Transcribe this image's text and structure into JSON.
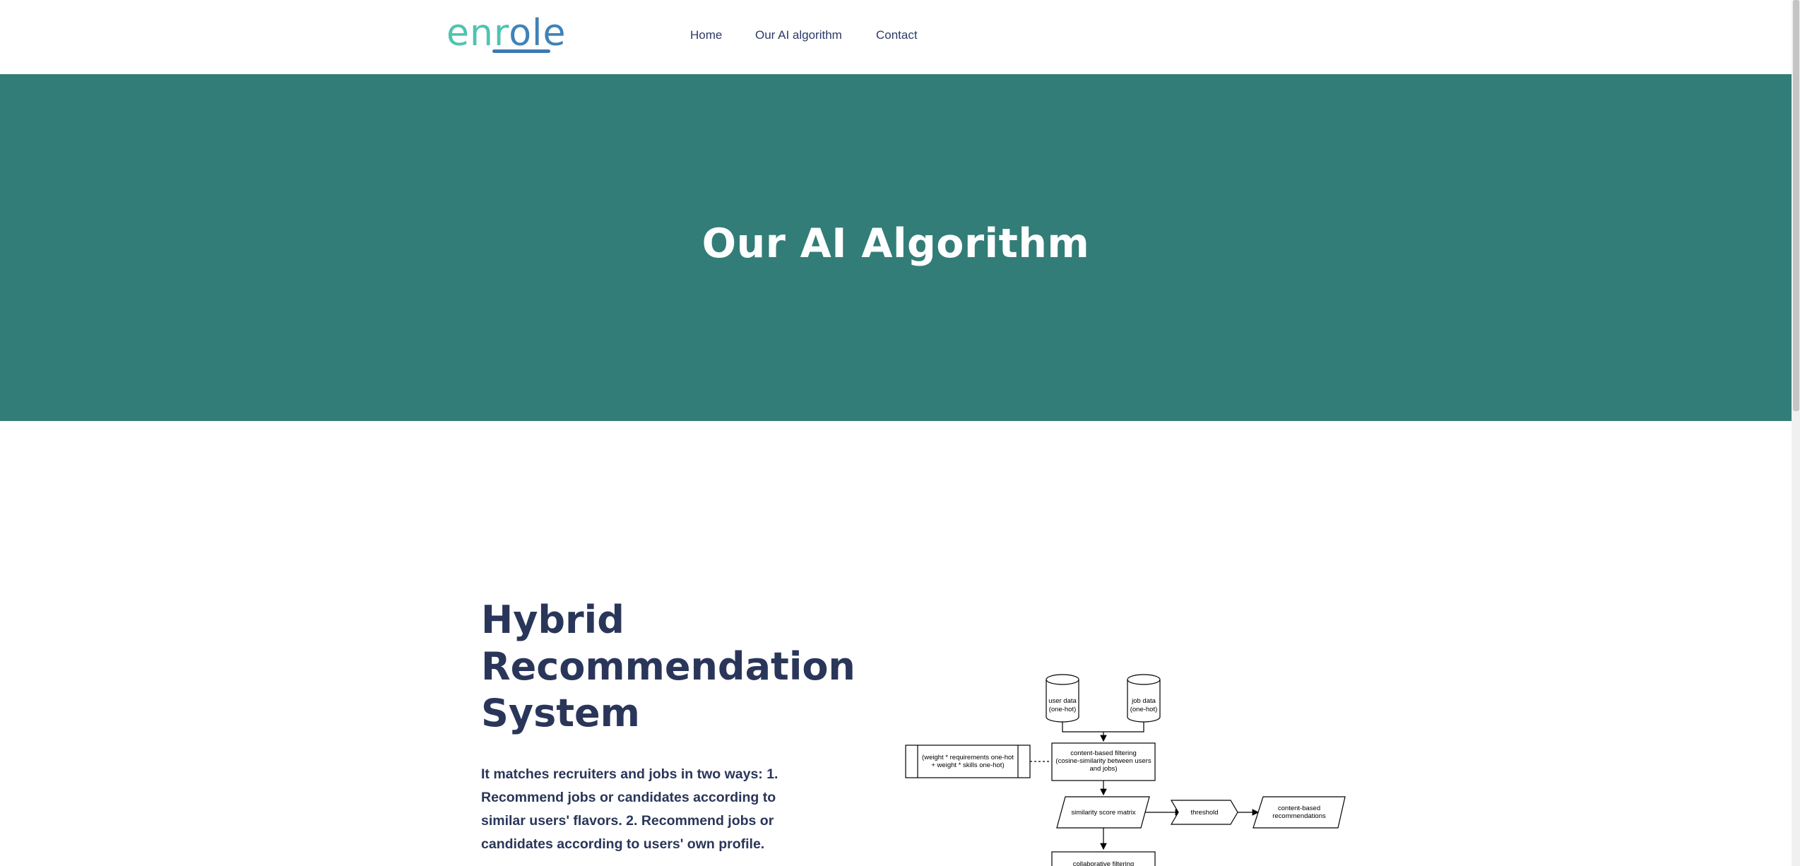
{
  "header": {
    "logo": "enrole",
    "nav": [
      {
        "label": "Home"
      },
      {
        "label": "Our AI algorithm"
      },
      {
        "label": "Contact"
      }
    ]
  },
  "hero": {
    "title": "Our AI Algorithm",
    "background": "#327d78"
  },
  "section": {
    "title": "Hybrid\nRecommendation\nSystem",
    "description": "It matches recruiters and jobs in two ways: 1. Recommend jobs or candidates according to similar users' flavors. 2. Recommend jobs or candidates according to users' own profile."
  },
  "diagram": {
    "user_data": [
      "user data",
      "(one-hot)"
    ],
    "job_data": [
      "job data",
      "(one-hot)"
    ],
    "weights": [
      "(weight * requirements one-hot",
      "+ weight * skills one-hot)"
    ],
    "content_filtering": [
      "content-based filtering",
      "(cosine-similarity between users",
      "and jobs)"
    ],
    "similarity_matrix": "similarity score matrix",
    "threshold": "threshold",
    "recommendations": [
      "content-based",
      "recommendations"
    ],
    "collaborative": "collaborative filtering"
  },
  "colors": {
    "accent": "#327d78",
    "text_dark": "#2a3659",
    "nav_text": "#2b3a67",
    "logo_teal": "#4fc3b0",
    "logo_blue": "#3f82b7"
  }
}
